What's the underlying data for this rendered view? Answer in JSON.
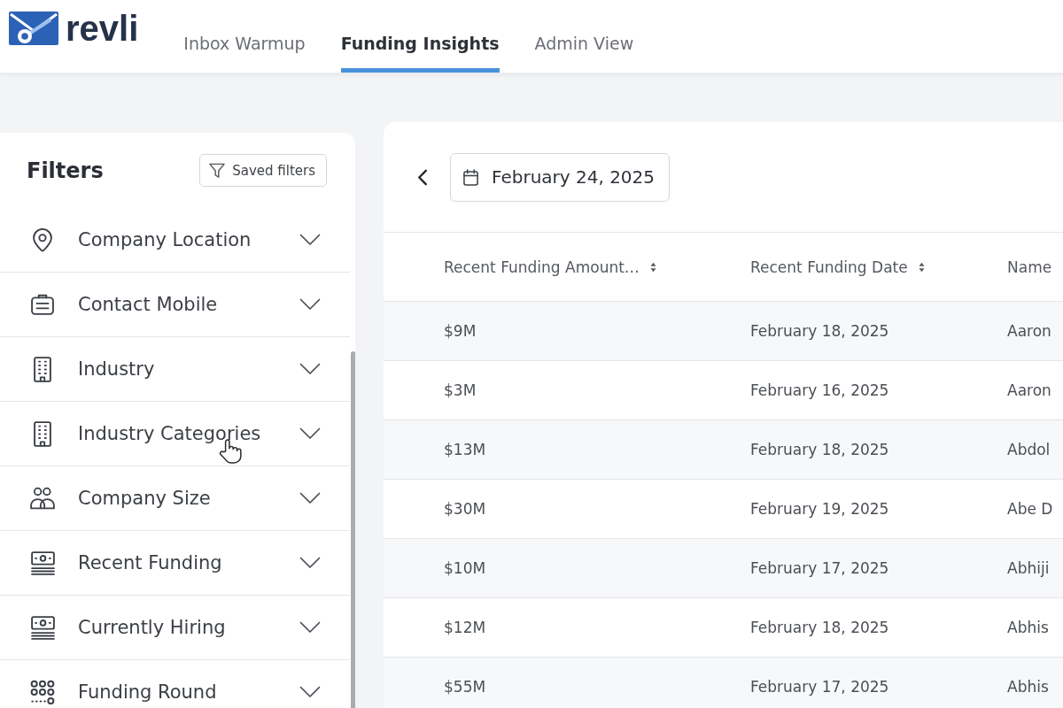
{
  "nav": {
    "logo": "revli",
    "tabs": [
      {
        "label": "Inbox Warmup",
        "selected": false
      },
      {
        "label": "Funding Insights",
        "selected": true
      },
      {
        "label": "Admin View",
        "selected": false
      }
    ]
  },
  "filters": {
    "title": "Filters",
    "saved_filters_button": "Saved filters",
    "items": [
      {
        "label": "Company Location",
        "expanded": false
      },
      {
        "label": "Contact Mobile",
        "expanded": false
      },
      {
        "label": "Industry",
        "expanded": false
      },
      {
        "label": "Industry Categories",
        "expanded": false
      },
      {
        "label": "Company Size",
        "expanded": false
      },
      {
        "label": "Recent Funding",
        "expanded": false
      },
      {
        "label": "Currently Hiring",
        "expanded": false
      },
      {
        "label": "Funding Round",
        "expanded": false
      }
    ]
  },
  "toolbar": {
    "date": "February 24, 2025"
  },
  "table": {
    "columns": [
      {
        "label": "Recent Funding Amount…",
        "sortable": true
      },
      {
        "label": "Recent Funding Date",
        "sortable": true
      },
      {
        "label": "Name"
      }
    ],
    "rows": [
      {
        "cells": [
          "$9M",
          "February 18, 2025",
          "Aaron"
        ]
      },
      {
        "cells": [
          "$3M",
          "February 16, 2025",
          "Aaron"
        ]
      },
      {
        "cells": [
          "$13M",
          "February 18, 2025",
          "Abdol"
        ]
      },
      {
        "cells": [
          "$30M",
          "February 19, 2025",
          "Abe D"
        ]
      },
      {
        "cells": [
          "$10M",
          "February 17, 2025",
          "Abhiji"
        ]
      },
      {
        "cells": [
          "$12M",
          "February 18, 2025",
          "Abhis"
        ]
      },
      {
        "cells": [
          "$55M",
          "February 17, 2025",
          "Abhis"
        ]
      }
    ]
  }
}
